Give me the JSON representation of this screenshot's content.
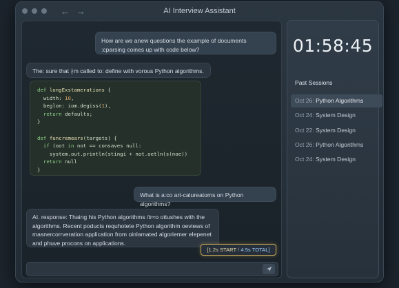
{
  "window": {
    "title": "AI Interview Assistant",
    "nav_back": "←",
    "nav_forward": "→"
  },
  "chat": {
    "messages": [
      {
        "role": "user",
        "text": "How are we anew questions the example of documents :cparsing coines up with code below?"
      },
      {
        "role": "ai",
        "text": "The: sure that ∤m called to: define with vorous Python algorithms."
      },
      {
        "role": "user",
        "text": "What is a:co art-calureatoms on Python algorithms?"
      },
      {
        "role": "ai",
        "text": "AI. response: Thaing his Python algorithms /tr≈o ottushes with the algorithms. Recent poducts requhotete Python algorithm oeviews of masnercorrveration application from oinlamated algoriemer elepenet and phuve procons on applications."
      }
    ],
    "code_lines": [
      [
        {
          "t": "def ",
          "c": "kw"
        },
        {
          "t": "longExstamerations",
          "c": "fn"
        },
        {
          "t": " {",
          "c": ""
        }
      ],
      [
        {
          "t": "  width: ",
          "c": ""
        },
        {
          "t": "10",
          "c": "nm"
        },
        {
          "t": ",",
          "c": ""
        }
      ],
      [
        {
          "t": "  beglon: iom.degiss(",
          "c": ""
        },
        {
          "t": "1",
          "c": "nm"
        },
        {
          "t": "),",
          "c": ""
        }
      ],
      [
        {
          "t": "  ",
          "c": ""
        },
        {
          "t": "return",
          "c": "kw"
        },
        {
          "t": " defaults;",
          "c": ""
        }
      ],
      [
        {
          "t": "}",
          "c": ""
        }
      ],
      [
        {
          "t": "",
          "c": ""
        }
      ],
      [
        {
          "t": "def ",
          "c": "kw"
        },
        {
          "t": "funcremears",
          "c": "fn"
        },
        {
          "t": "(targets) {",
          "c": ""
        }
      ],
      [
        {
          "t": "  ",
          "c": ""
        },
        {
          "t": "if",
          "c": "kw"
        },
        {
          "t": " (oot ",
          "c": ""
        },
        {
          "t": "in",
          "c": "kw"
        },
        {
          "t": " not == consaves null:",
          "c": ""
        }
      ],
      [
        {
          "t": "    system.out.println(stingi + not.oetln(s(noe))",
          "c": ""
        }
      ],
      [
        {
          "t": "  ",
          "c": ""
        },
        {
          "t": "return",
          "c": "kw"
        },
        {
          "t": " null",
          "c": ""
        }
      ],
      [
        {
          "t": "}",
          "c": ""
        }
      ]
    ],
    "timing": {
      "start": "[1.2s START",
      "separator": " / ",
      "total": "4.5s TOTAL]"
    },
    "input": {
      "value": "",
      "placeholder": ""
    },
    "send_icon": "send-icon"
  },
  "sidebar": {
    "timer": "01:58:45",
    "sessions_title": "Past Sessions",
    "sessions": [
      {
        "date": "Oct 26:",
        "topic": "Python Algorithms",
        "active": true
      },
      {
        "date": "Oct 24:",
        "topic": "System Design",
        "active": false
      },
      {
        "date": "Oct 22:",
        "topic": "System Design",
        "active": false
      },
      {
        "date": "Oct 26:",
        "topic": "Python Algorithms",
        "active": false
      },
      {
        "date": "Oct 24:",
        "topic": "System Design",
        "active": false
      }
    ]
  },
  "colors": {
    "accent_timing_border": "#c7a85a",
    "code_keyword": "#8fd08a",
    "active_session_bg": "#3d4a58"
  }
}
